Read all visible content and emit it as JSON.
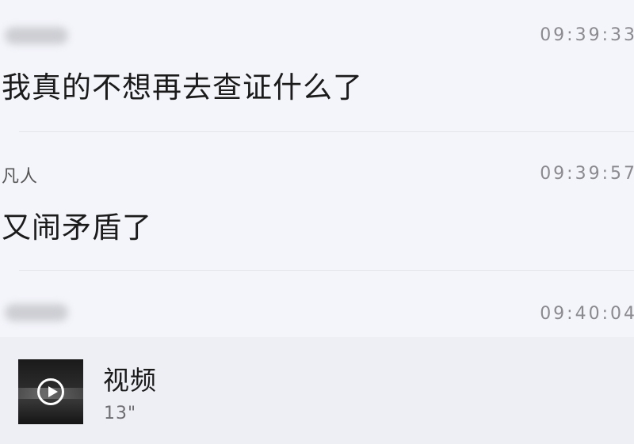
{
  "messages": [
    {
      "sender": "",
      "sender_blurred": true,
      "time": "09:39:33",
      "text": "我真的不想再去查证什么了"
    },
    {
      "sender": "凡人",
      "sender_blurred": false,
      "time": "09:39:57",
      "text": "又闹矛盾了"
    },
    {
      "sender": "",
      "sender_blurred": true,
      "time": "09:40:04",
      "video": {
        "label": "视频",
        "duration": "13\"",
        "icon": "play-circle-icon"
      }
    }
  ],
  "colors": {
    "background": "#f4f5fb",
    "card_background": "#eeeff5",
    "timestamp": "#8a8a8f",
    "text": "#1b1b1b"
  }
}
